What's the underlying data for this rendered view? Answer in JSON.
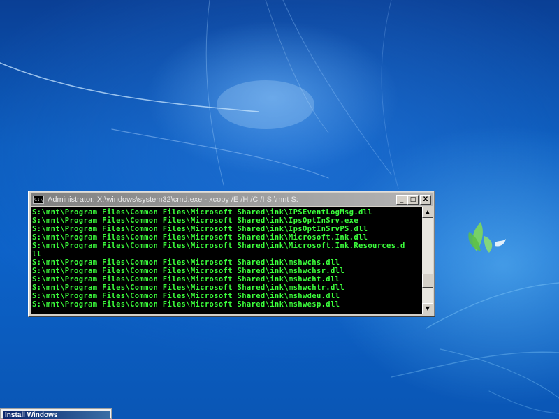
{
  "cmd_window": {
    "title": "Administrator: X:\\windows\\system32\\cmd.exe - xcopy  /E /H /C /I S:\\mnt S:",
    "icon_label": "C:\\.",
    "minimize_label": "_",
    "maximize_label": "□",
    "close_label": "X",
    "scroll_up_label": "▲",
    "scroll_down_label": "▼",
    "scroll_position": 0.78,
    "lines": [
      "S:\\mnt\\Program Files\\Common Files\\Microsoft Shared\\ink\\IPSEventLogMsg.dll",
      "S:\\mnt\\Program Files\\Common Files\\Microsoft Shared\\ink\\IpsOptInSrv.exe",
      "S:\\mnt\\Program Files\\Common Files\\Microsoft Shared\\ink\\IpsOptInSrvPS.dll",
      "S:\\mnt\\Program Files\\Common Files\\Microsoft Shared\\ink\\Microsoft.Ink.dll",
      "S:\\mnt\\Program Files\\Common Files\\Microsoft Shared\\ink\\Microsoft.Ink.Resources.d",
      "ll",
      "S:\\mnt\\Program Files\\Common Files\\Microsoft Shared\\ink\\mshwchs.dll",
      "S:\\mnt\\Program Files\\Common Files\\Microsoft Shared\\ink\\mshwchsr.dll",
      "S:\\mnt\\Program Files\\Common Files\\Microsoft Shared\\ink\\mshwcht.dll",
      "S:\\mnt\\Program Files\\Common Files\\Microsoft Shared\\ink\\mshwchtr.dll",
      "S:\\mnt\\Program Files\\Common Files\\Microsoft Shared\\ink\\mshwdeu.dll",
      "S:\\mnt\\Program Files\\Common Files\\Microsoft Shared\\ink\\mshwesp.dll"
    ]
  },
  "install_window": {
    "title": "Install Windows"
  },
  "desktop": {
    "wallpaper_colors": [
      "#0a3f95",
      "#0c62c8"
    ],
    "logo_icon": "windows-fish-logo"
  }
}
